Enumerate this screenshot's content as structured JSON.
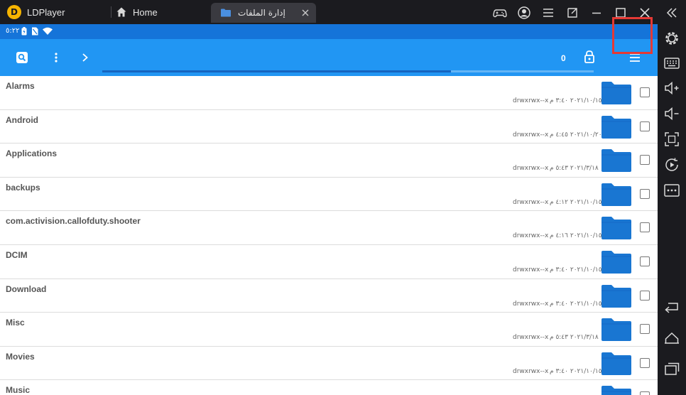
{
  "titlebar": {
    "app_name": "LDPlayer",
    "logo_glyph": "D",
    "tabs": [
      {
        "label": "Home",
        "icon": "home-icon"
      },
      {
        "label": "إدارة الملفات",
        "icon": "folder-icon"
      }
    ],
    "controls": [
      "gamepad-icon",
      "account-icon",
      "menu-icon",
      "resize-icon",
      "minimize-icon",
      "maximize-icon",
      "close-icon",
      "collapse-icon"
    ]
  },
  "statusbar": {
    "time": "٥:٢٢"
  },
  "appbar": {
    "count": "0",
    "progress": 0.71
  },
  "files": [
    {
      "name": "Alarms",
      "perm": "drwxrwx--x",
      "date": "٢٠٢١/١٠/١٥ ٣:٤٠ م"
    },
    {
      "name": "Android",
      "perm": "drwxrwx--x",
      "date": "٢٠٢١/١٠/٢٠ ٤:٤٥ م"
    },
    {
      "name": "Applications",
      "perm": "drwxrwx--x",
      "date": "٢٠٢١/٣/١٨ ٥:٤٣ م"
    },
    {
      "name": "backups",
      "perm": "drwxrwx--x",
      "date": "٢٠٢١/١٠/١٥ ٤:١٢ م"
    },
    {
      "name": "com.activision.callofduty.shooter",
      "perm": "drwxrwx--x",
      "date": "٢٠٢١/١٠/١٥ ٤:١٦ م"
    },
    {
      "name": "DCIM",
      "perm": "drwxrwx--x",
      "date": "٢٠٢١/١٠/١٥ ٣:٤٠ م"
    },
    {
      "name": "Download",
      "perm": "drwxrwx--x",
      "date": "٢٠٢١/١٠/١٥ ٣:٤٠ م"
    },
    {
      "name": "Misc",
      "perm": "drwxrwx--x",
      "date": "٢٠٢١/٣/١٨ ٥:٤٣ م"
    },
    {
      "name": "Movies",
      "perm": "drwxrwx--x",
      "date": "٢٠٢١/١٠/١٥ ٣:٤٠ م"
    },
    {
      "name": "Music",
      "perm": "",
      "date": ""
    }
  ],
  "colors": {
    "accent": "#2196f3",
    "statusbar": "#1574d9",
    "folder": "#1976d2",
    "highlight": "#e53935"
  }
}
